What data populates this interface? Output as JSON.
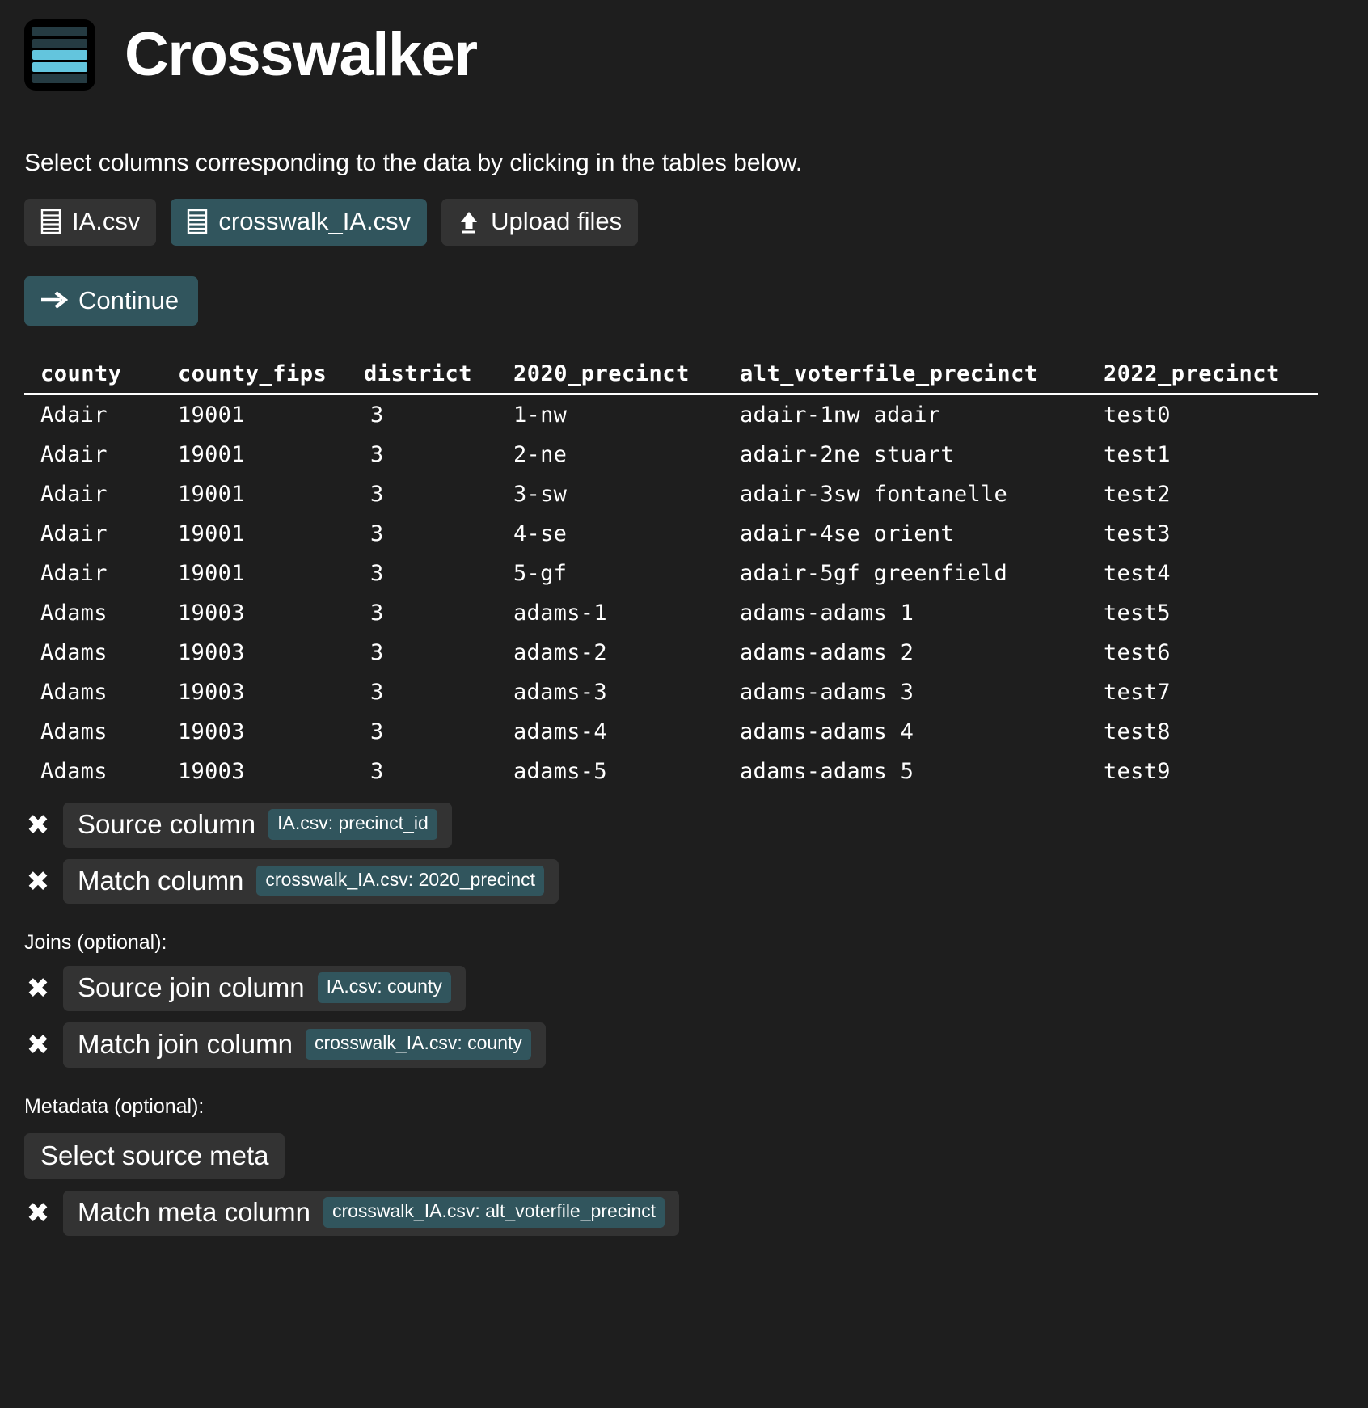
{
  "app": {
    "title": "Crosswalker",
    "logo_icon": "stacked-bars-logo",
    "logo_colors": {
      "dark": "#253b42",
      "light": "#63c5dd",
      "background": "#000000"
    }
  },
  "theme": {
    "background": "#1e1e1e",
    "button": "#333333",
    "accent": "#31555d",
    "text": "#ffffff"
  },
  "intro": {
    "text": "Select columns corresponding to the data by clicking in the tables below."
  },
  "filebar": {
    "buttons": [
      {
        "label": "IA.csv",
        "icon": "table-file-icon",
        "active": false
      },
      {
        "label": "crosswalk_IA.csv",
        "icon": "table-file-icon",
        "active": true
      },
      {
        "label": "Upload files",
        "icon": "upload-icon",
        "active": false
      }
    ],
    "continue": {
      "label": "Continue",
      "icon": "arrow-right-icon"
    }
  },
  "table": {
    "columns": [
      "county",
      "county_fips",
      "district",
      "2020_precinct",
      "alt_voterfile_precinct",
      "2022_precinct"
    ],
    "rows": [
      [
        "Adair",
        "19001",
        "3",
        "1-nw",
        "adair-1nw adair",
        "test0"
      ],
      [
        "Adair",
        "19001",
        "3",
        "2-ne",
        "adair-2ne stuart",
        "test1"
      ],
      [
        "Adair",
        "19001",
        "3",
        "3-sw",
        "adair-3sw fontanelle",
        "test2"
      ],
      [
        "Adair",
        "19001",
        "3",
        "4-se",
        "adair-4se orient",
        "test3"
      ],
      [
        "Adair",
        "19001",
        "3",
        "5-gf",
        "adair-5gf greenfield",
        "test4"
      ],
      [
        "Adams",
        "19003",
        "3",
        "adams-1",
        "adams-adams 1",
        "test5"
      ],
      [
        "Adams",
        "19003",
        "3",
        "adams-2",
        "adams-adams 2",
        "test6"
      ],
      [
        "Adams",
        "19003",
        "3",
        "adams-3",
        "adams-adams 3",
        "test7"
      ],
      [
        "Adams",
        "19003",
        "3",
        "adams-4",
        "adams-adams 4",
        "test8"
      ],
      [
        "Adams",
        "19003",
        "3",
        "adams-5",
        "adams-adams 5",
        "test9"
      ]
    ]
  },
  "selections": {
    "primary": [
      {
        "clear_icon": "x-icon",
        "label": "Source column",
        "value": "IA.csv: precinct_id"
      },
      {
        "clear_icon": "x-icon",
        "label": "Match column",
        "value": "crosswalk_IA.csv: 2020_precinct"
      }
    ],
    "joins_heading": "Joins (optional):",
    "joins": [
      {
        "clear_icon": "x-icon",
        "label": "Source join column",
        "value": "IA.csv: county"
      },
      {
        "clear_icon": "x-icon",
        "label": "Match join column",
        "value": "crosswalk_IA.csv: county"
      }
    ],
    "metadata_heading": "Metadata (optional):",
    "metadata_source_button": "Select source meta",
    "metadata": [
      {
        "clear_icon": "x-icon",
        "label": "Match meta column",
        "value": "crosswalk_IA.csv: alt_voterfile_precinct"
      }
    ]
  }
}
